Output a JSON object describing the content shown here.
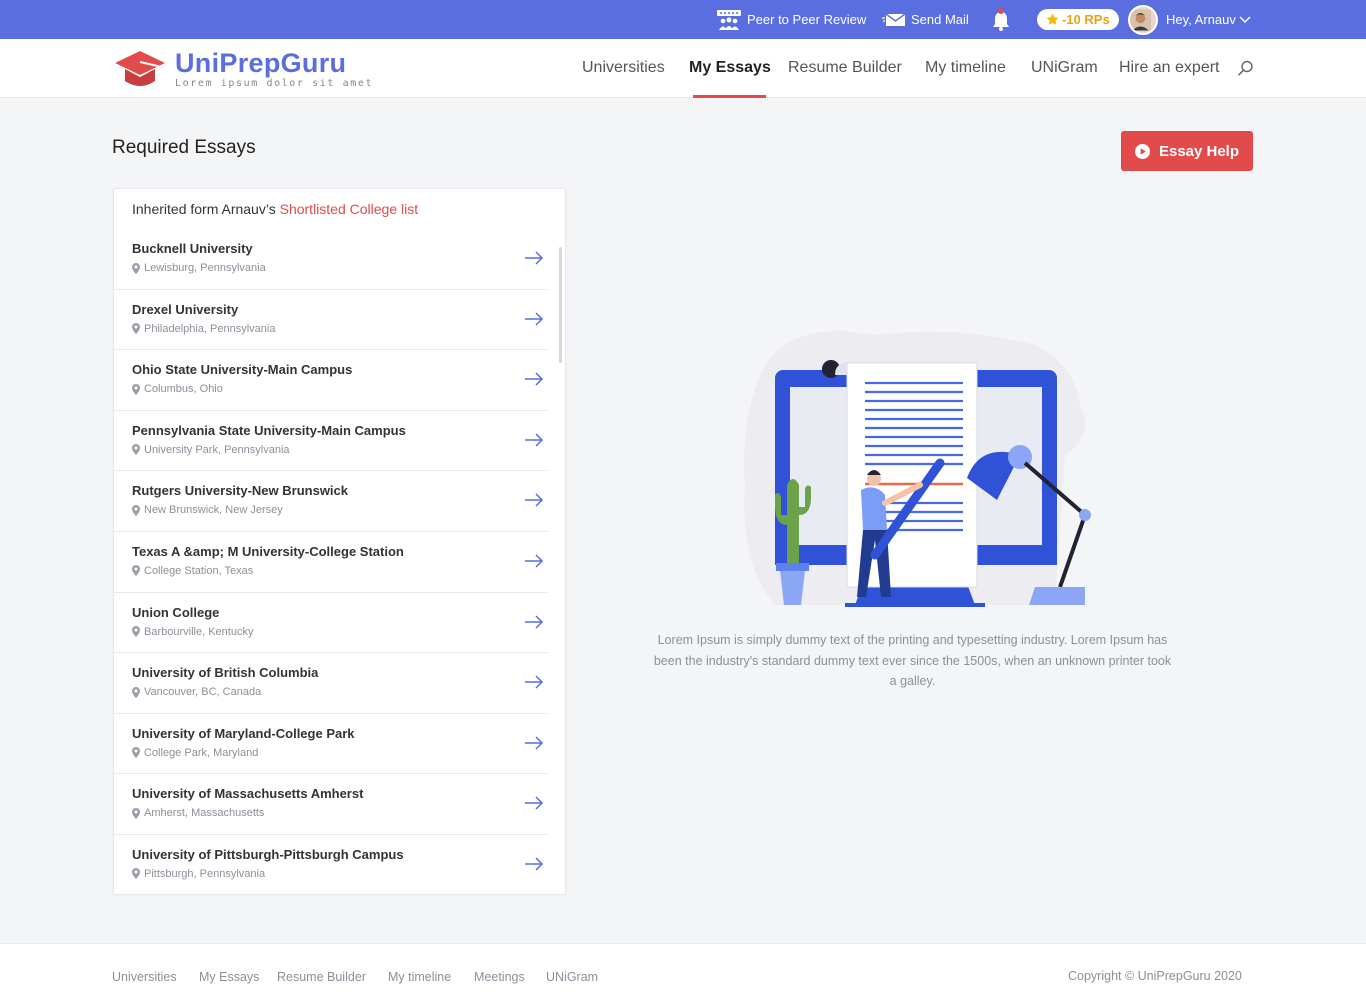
{
  "topbar": {
    "peer_review": "Peer to Peer Review",
    "send_mail": "Send Mail",
    "rp_badge": "-10 RPs",
    "greeting": "Hey, Arnauv"
  },
  "brand": {
    "name": "UniPrepGuru",
    "tagline": "Lorem ipsum dolor sit amet",
    "accent": "#5a6ee0",
    "red": "#e14b4b"
  },
  "nav": {
    "items": [
      "Universities",
      "My Essays",
      "Resume Builder",
      "My timeline",
      "UNiGram",
      "Hire an expert"
    ],
    "active": "My Essays"
  },
  "main": {
    "title": "Required Essays",
    "essay_help": "Essay Help",
    "card_prefix": "Inherited form Arnauv’s ",
    "card_link": "Shortlisted College list",
    "universities": [
      {
        "name": "Bucknell University",
        "location": "Lewisburg, Pennsylvania"
      },
      {
        "name": "Drexel University",
        "location": "Philadelphia, Pennsylvania"
      },
      {
        "name": "Ohio State University-Main Campus",
        "location": "Columbus, Ohio"
      },
      {
        "name": "Pennsylvania State University-Main Campus",
        "location": "University Park, Pennsylvania"
      },
      {
        "name": "Rutgers University-New Brunswick",
        "location": "New Brunswick, New Jersey"
      },
      {
        "name": "Texas A &amp; M University-College Station",
        "location": "College Station, Texas"
      },
      {
        "name": "Union College",
        "location": "Barbourville, Kentucky"
      },
      {
        "name": "University of British Columbia",
        "location": "Vancouver, BC, Canada"
      },
      {
        "name": "University of Maryland-College Park",
        "location": "College Park, Maryland"
      },
      {
        "name": "University of Massachusetts Amherst",
        "location": "Amherst, Massachusetts"
      },
      {
        "name": "University of Pittsburgh-Pittsburgh Campus",
        "location": "Pittsburgh, Pennsylvania"
      }
    ],
    "description": "Lorem Ipsum is simply dummy text of the printing and typesetting industry. Lorem Ipsum has been the industry's standard dummy text ever since the 1500s, when an unknown printer took a galley."
  },
  "footer": {
    "links": [
      "Universities",
      "My Essays",
      "Resume Builder",
      "My timeline",
      "Meetings",
      "UNiGram"
    ],
    "copyright": "Copyright © UniPrepGuru 2020"
  }
}
